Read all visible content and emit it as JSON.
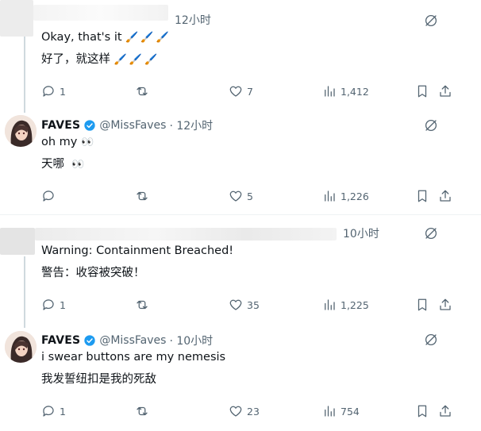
{
  "tweets": [
    {
      "time": "12小时",
      "line1": "Okay, that's it",
      "line1_emoji": "🖌️🖌️🖌️",
      "line2": "好了，就这样",
      "line2_emoji": "🖌️🖌️🖌️",
      "replies": "1",
      "retweets": "",
      "likes": "7",
      "views": "1,412"
    },
    {
      "name": "FAVES",
      "handle": "@MissFaves",
      "time": "· 12小时",
      "line1": "oh my",
      "line1_emoji": "👀",
      "line2": "天哪",
      "line2_emoji": "👀",
      "replies": "",
      "retweets": "",
      "likes": "5",
      "views": "1,226"
    },
    {
      "time": "10小时",
      "line1": "Warning: Containment Breached!",
      "line2": "警告：收容被突破！",
      "replies": "1",
      "retweets": "",
      "likes": "35",
      "views": "1,225"
    },
    {
      "name": "FAVES",
      "handle": "@MissFaves",
      "time": "· 10小时",
      "line1": "i swear buttons are my nemesis",
      "line2": "我发誓纽扣是我的死敌",
      "replies": "1",
      "retweets": "",
      "likes": "23",
      "views": "754"
    }
  ],
  "colors": {
    "verified": "#1d9bf0",
    "icon_gray": "#536471",
    "divider": "#eff3f4"
  },
  "icons": [
    "reply-icon",
    "retweet-icon",
    "heart-icon",
    "views-icon",
    "bookmark-icon",
    "share-icon",
    "grok-icon",
    "verified-badge-icon"
  ]
}
